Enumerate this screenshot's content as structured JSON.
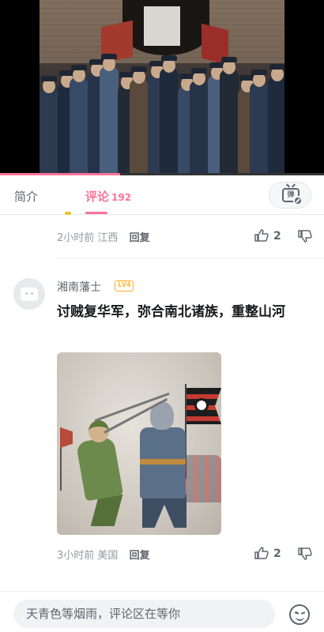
{
  "video": {
    "watermark": "",
    "progress_fraction": 0.37
  },
  "tabs": {
    "intro_label": "简介",
    "comments_label": "评论",
    "comments_count": "192",
    "active": "comments",
    "danmaku_icon_text": "弹",
    "accent_color": "#fb7299"
  },
  "comments": [
    {
      "time": "2小时前",
      "location": "江西",
      "reply_label": "回复",
      "likes": "2"
    },
    {
      "username": "湘南藩士",
      "level": "LV4",
      "text": "讨贼复华军，弥合南北诸族，重整山河",
      "has_image": true,
      "time": "3小时前",
      "location": "美国",
      "reply_label": "回复",
      "likes": "2"
    }
  ],
  "input": {
    "placeholder": "天青色等烟雨，评论区在等你"
  },
  "icons": {
    "like": "thumb-up-icon",
    "dislike": "thumb-down-icon",
    "emoji": "smile-icon",
    "danmaku": "danmaku-off-icon",
    "avatar": "default-avatar-icon"
  }
}
